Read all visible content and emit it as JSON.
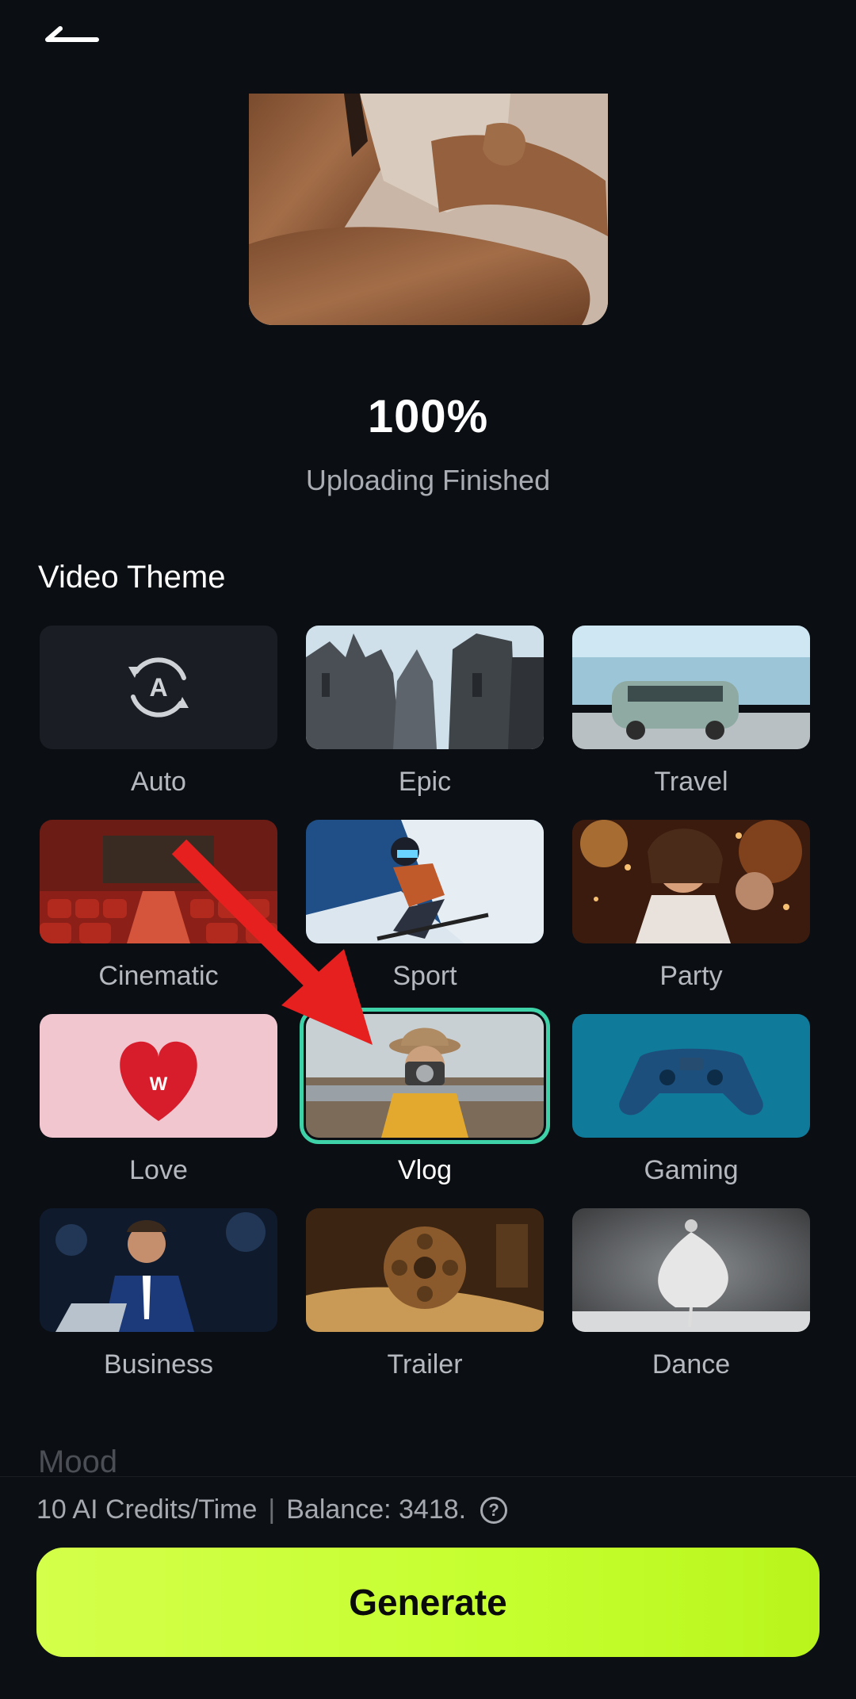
{
  "header": {
    "back_icon": "back-arrow-icon"
  },
  "preview": {
    "image": "woman-crossed-arms-photo"
  },
  "upload": {
    "percent": "100%",
    "status": "Uploading Finished"
  },
  "video_theme": {
    "title": "Video Theme",
    "selected": "Vlog",
    "items": [
      {
        "label": "Auto"
      },
      {
        "label": "Epic"
      },
      {
        "label": "Travel"
      },
      {
        "label": "Cinematic"
      },
      {
        "label": "Sport"
      },
      {
        "label": "Party"
      },
      {
        "label": "Love"
      },
      {
        "label": "Vlog"
      },
      {
        "label": "Gaming"
      },
      {
        "label": "Business"
      },
      {
        "label": "Trailer"
      },
      {
        "label": "Dance"
      }
    ]
  },
  "mood": {
    "title": "Mood"
  },
  "footer": {
    "credits_text": "10 AI Credits/Time",
    "separator": "|",
    "balance_text": "Balance: 3418.",
    "help_icon": "question-circle-icon",
    "generate_label": "Generate"
  },
  "colors": {
    "background": "#0b0e12",
    "accent_selected": "#3fd2a8",
    "generate_button": "#c5ff2f",
    "annotation_arrow": "#e5201f"
  }
}
